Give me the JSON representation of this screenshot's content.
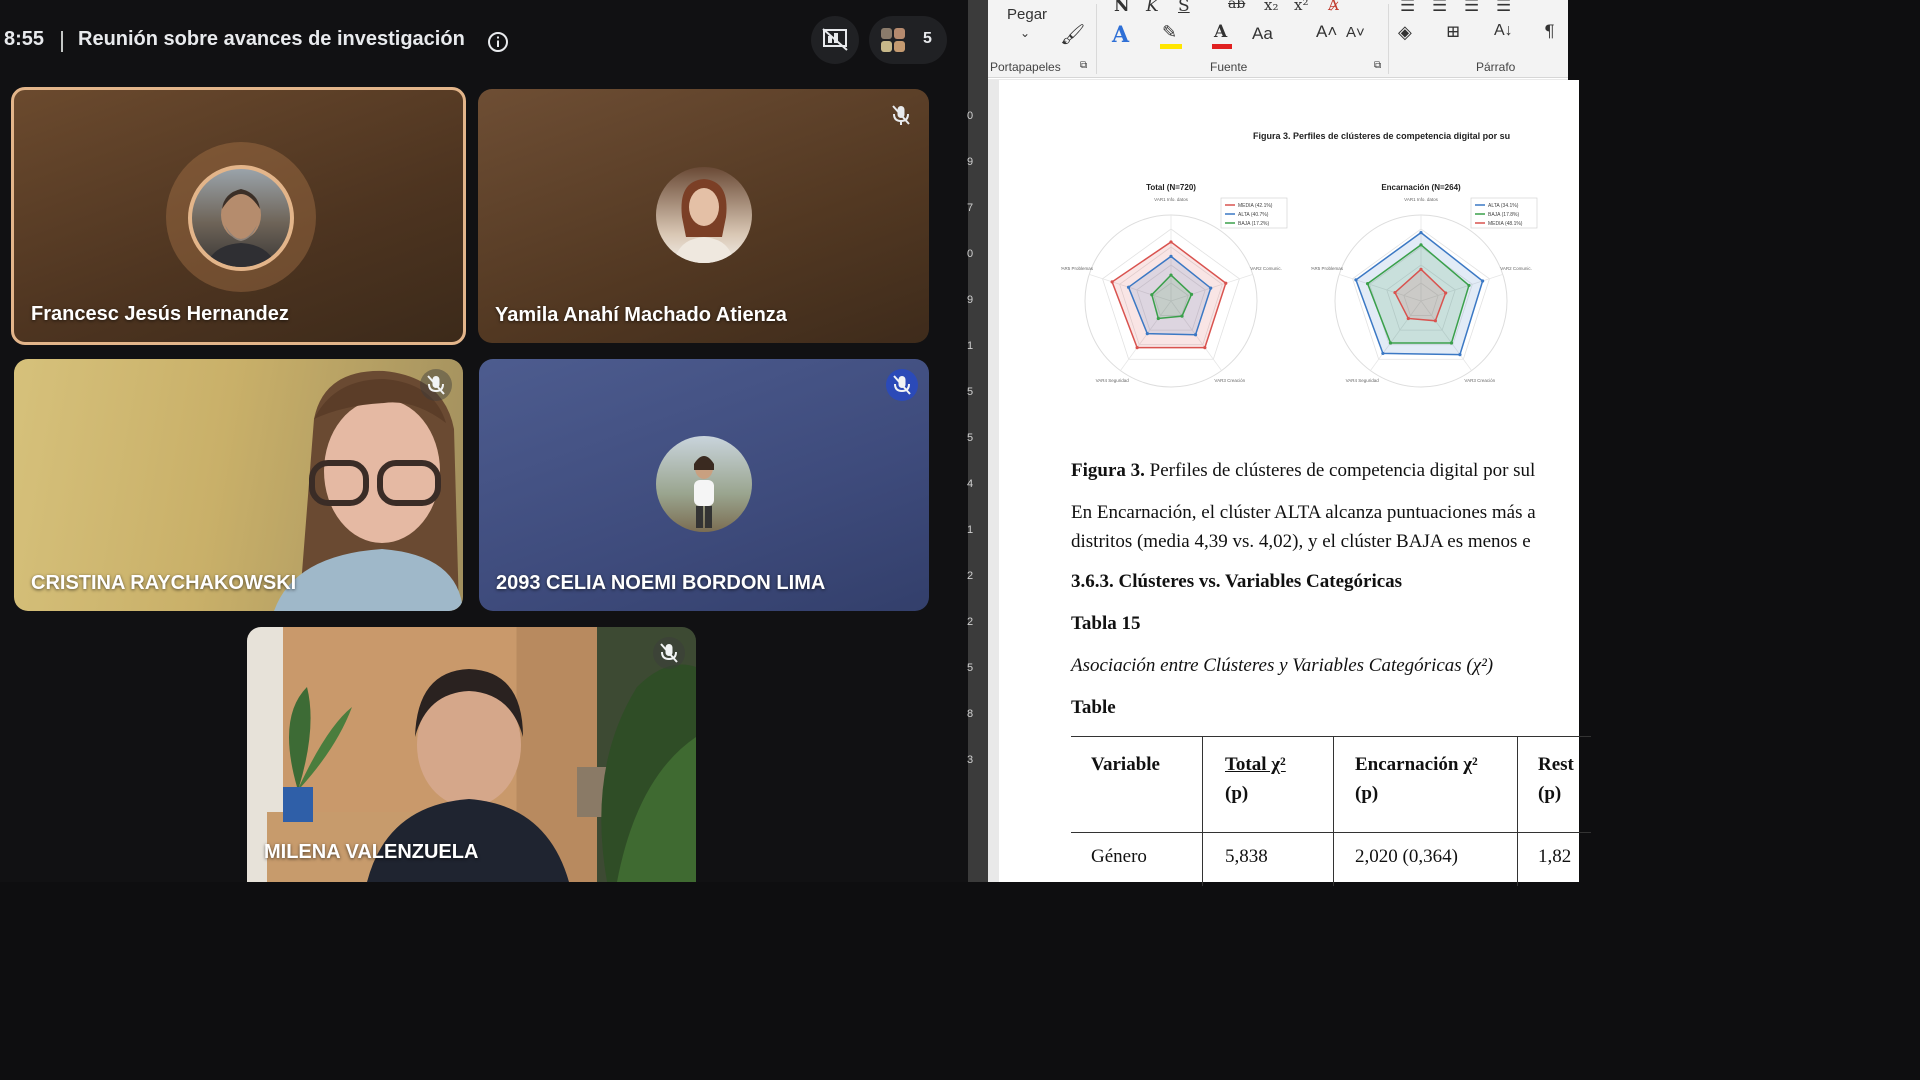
{
  "meeting": {
    "time": "8:55",
    "title": "Reunión sobre avances de investigación",
    "participant_count": "5"
  },
  "participants": [
    {
      "name": "Francesc Jesús Hernandez",
      "muted": false,
      "speaking": true
    },
    {
      "name": "Yamila Anahí Machado Atienza",
      "muted": true
    },
    {
      "name": "CRISTINA RAYCHAKOWSKI",
      "muted": true,
      "camera_on": true
    },
    {
      "name": "2093 CELIA NOEMI BORDON LIMA",
      "muted": true
    },
    {
      "name": "MILENA VALENZUELA",
      "muted": true,
      "camera_on": true
    }
  ],
  "word": {
    "ribbon": {
      "paste_label": "Pegar",
      "clipboard_label": "Portapapeles",
      "font_label": "Fuente",
      "paragraph_label": "Párrafo",
      "font_size_btn": "Aa",
      "bold_glyph": "N",
      "italic_glyph": "K",
      "underline_glyph": "S"
    },
    "figure": {
      "title": "Figura 3. Perfiles de clústeres de competencia digital por su",
      "charts": [
        {
          "title": "Total (N=720)",
          "legend": [
            "MEDIA (42.1%)",
            "ALTA (40.7%)",
            "BAJA (17.2%)"
          ]
        },
        {
          "title": "Encarnación (N=264)",
          "legend": [
            "ALTA (34.1%)",
            "BAJA (17.8%)",
            "MEDIA (48.1%)"
          ]
        }
      ],
      "axes": [
        "VAR1 Info. datos",
        "VAR2 Comunic.",
        "VAR3 Creación",
        "VAR4 Seguridad",
        "VAR5 Problemas"
      ],
      "colors": {
        "alta": "#d9534f",
        "media": "#3b78c4",
        "baja": "#3aa04b"
      }
    },
    "doc": {
      "caption_bold": "Figura 3.",
      "caption_rest": "Perfiles de clústeres de competencia digital por sul",
      "para_line1": "En Encarnación, el clúster ALTA alcanza puntuaciones más a",
      "para_line2": "distritos (media 4,39 vs. 4,02), y el clúster BAJA es menos e",
      "heading": "3.6.3. Clústeres vs. Variables Categóricas",
      "table_num": "Tabla 15",
      "table_title": "Asociación entre Clústeres y Variables Categóricas (χ²)",
      "table_word": "Table",
      "table": {
        "headers": [
          {
            "l1": "Variable",
            "l2": ""
          },
          {
            "l1": "Total χ²",
            "l2": "(p)"
          },
          {
            "l1": "Encarnación χ²",
            "l2": "(p)"
          },
          {
            "l1": "Rest",
            "l2": "(p)"
          }
        ],
        "rows": [
          [
            "Género",
            "5,838",
            "2,020 (0,364)",
            "1,82"
          ]
        ]
      }
    }
  },
  "ruler_marks": [
    "0",
    "9",
    "7",
    "0",
    "9",
    "1",
    "5",
    "5",
    "4",
    "1",
    "2",
    "2",
    "5",
    "8",
    "3"
  ]
}
